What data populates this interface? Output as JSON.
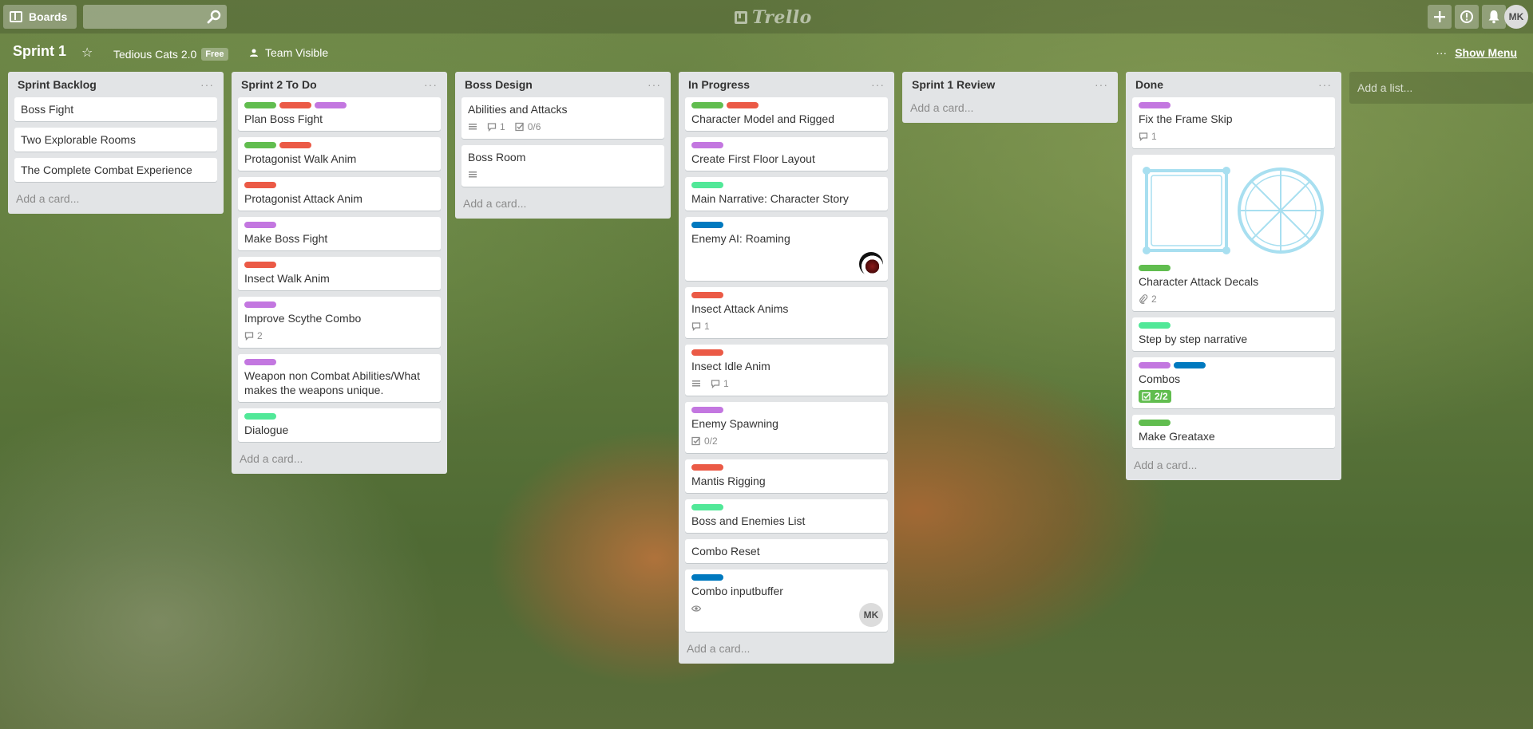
{
  "header": {
    "boards_label": "Boards",
    "search_placeholder": "",
    "logo_text": "Trello",
    "avatar_initials": "MK"
  },
  "board": {
    "title": "Sprint 1",
    "team_name": "Tedious Cats 2.0",
    "plan_badge": "Free",
    "visibility": "Team Visible",
    "menu_label": "Show Menu",
    "add_list": "Add a list..."
  },
  "colors": {
    "green": "#61bd4f",
    "red": "#eb5a46",
    "purple": "#c377e0",
    "lime": "#51e898",
    "blue": "#0079bf"
  },
  "lists": [
    {
      "title": "Sprint Backlog",
      "add_card": "Add a card...",
      "cards": [
        {
          "title": "Boss Fight"
        },
        {
          "title": "Two Explorable Rooms"
        },
        {
          "title": "The Complete Combat Experience"
        }
      ]
    },
    {
      "title": "Sprint 2 To Do",
      "add_card": "Add a card...",
      "cards": [
        {
          "title": "Plan Boss Fight",
          "labels": [
            "green",
            "red",
            "purple"
          ]
        },
        {
          "title": "Protagonist Walk Anim",
          "labels": [
            "green",
            "red"
          ]
        },
        {
          "title": "Protagonist Attack Anim",
          "labels": [
            "red"
          ]
        },
        {
          "title": "Make Boss Fight",
          "labels": [
            "purple"
          ]
        },
        {
          "title": "Insect Walk Anim",
          "labels": [
            "red"
          ]
        },
        {
          "title": "Improve Scythe Combo",
          "labels": [
            "purple"
          ],
          "comments": "2"
        },
        {
          "title": "Weapon non Combat Abilities/What makes the weapons unique.",
          "labels": [
            "purple"
          ]
        },
        {
          "title": "Dialogue",
          "labels": [
            "lime"
          ]
        }
      ]
    },
    {
      "title": "Boss Design",
      "add_card": "Add a card...",
      "cards": [
        {
          "title": "Abilities and Attacks",
          "description": true,
          "comments": "1",
          "checklist": "0/6"
        },
        {
          "title": "Boss Room",
          "description": true
        }
      ]
    },
    {
      "title": "In Progress",
      "add_card": "Add a card...",
      "cards": [
        {
          "title": "Character Model and Rigged",
          "labels": [
            "green",
            "red"
          ]
        },
        {
          "title": "Create First Floor Layout",
          "labels": [
            "purple"
          ]
        },
        {
          "title": "Main Narrative: Character Story",
          "labels": [
            "lime"
          ]
        },
        {
          "title": "Enemy AI: Roaming",
          "labels": [
            "blue"
          ],
          "member": "dark"
        },
        {
          "title": "Insect Attack Anims",
          "labels": [
            "red"
          ],
          "comments": "1"
        },
        {
          "title": "Insect Idle Anim",
          "labels": [
            "red"
          ],
          "description": true,
          "comments": "1"
        },
        {
          "title": "Enemy Spawning",
          "labels": [
            "purple"
          ],
          "checklist": "0/2"
        },
        {
          "title": "Mantis Rigging",
          "labels": [
            "red"
          ]
        },
        {
          "title": "Boss and Enemies List",
          "labels": [
            "lime"
          ]
        },
        {
          "title": "Combo Reset"
        },
        {
          "title": "Combo inputbuffer",
          "labels": [
            "blue"
          ],
          "watching": true,
          "member": "MK"
        }
      ]
    },
    {
      "title": "Sprint 1 Review",
      "add_card": "Add a card...",
      "cards": []
    },
    {
      "title": "Done",
      "add_card": "Add a card...",
      "cards": [
        {
          "title": "Fix the Frame Skip",
          "labels": [
            "purple"
          ],
          "comments": "1"
        },
        {
          "title": "Character Attack Decals",
          "labels": [
            "green"
          ],
          "attachments": "2",
          "cover": true
        },
        {
          "title": "Step by step narrative",
          "labels": [
            "lime"
          ]
        },
        {
          "title": "Combos",
          "labels": [
            "purple",
            "blue"
          ],
          "checklist_complete": "2/2"
        },
        {
          "title": "Make Greataxe",
          "labels": [
            "green"
          ]
        }
      ]
    }
  ]
}
